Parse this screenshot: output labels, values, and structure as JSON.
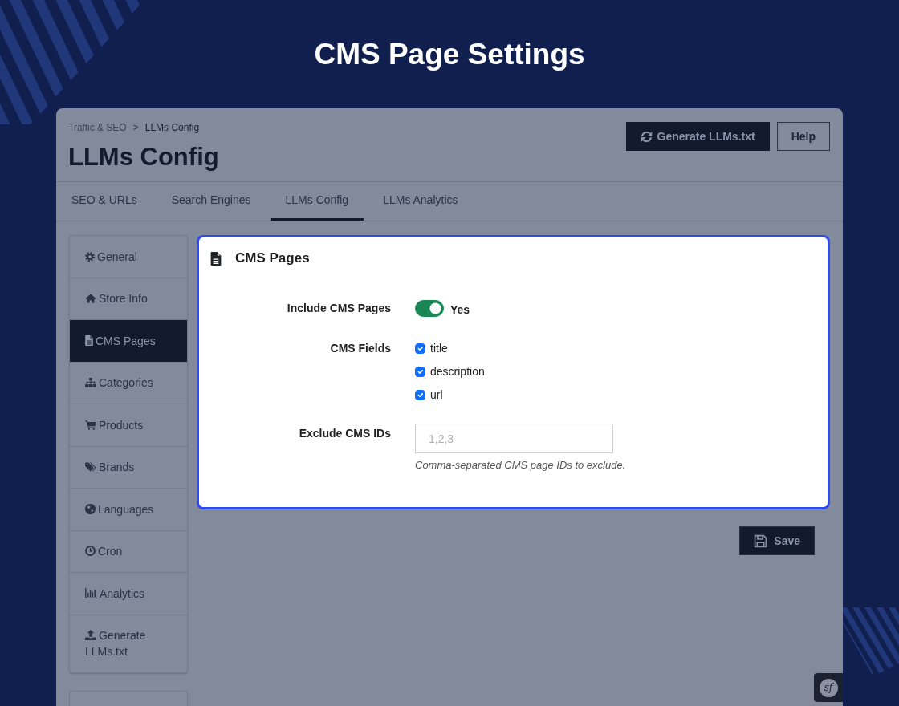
{
  "heading": {
    "title": "CMS Page Settings"
  },
  "header": {
    "breadcrumb": [
      {
        "label": "Traffic & SEO"
      },
      {
        "label": "LLMs Config"
      }
    ],
    "separator": ">",
    "title": "LLMs Config",
    "buttons": [
      {
        "label": "Generate LLMs.txt",
        "kind": "primary"
      },
      {
        "label": "Help",
        "kind": "outline"
      }
    ]
  },
  "tabs": [
    {
      "label": "SEO & URLs",
      "selected": false
    },
    {
      "label": "Search Engines",
      "selected": false
    },
    {
      "label": "LLMs Config",
      "selected": true
    },
    {
      "label": "LLMs Analytics",
      "selected": false
    }
  ],
  "sidebar": {
    "items": [
      {
        "label": "General",
        "selected": false
      },
      {
        "label": "Store Info",
        "selected": false
      },
      {
        "label": "CMS Pages",
        "selected": true
      },
      {
        "label": "Categories",
        "selected": false
      },
      {
        "label": "Products",
        "selected": false
      },
      {
        "label": "Brands",
        "selected": false
      },
      {
        "label": "Languages",
        "selected": false
      },
      {
        "label": "Cron",
        "selected": false
      },
      {
        "label": "Analytics",
        "selected": false
      },
      {
        "label": "Generate LLMs.txt",
        "selected": false
      }
    ]
  },
  "card": {
    "title": "CMS Pages",
    "fields": [
      {
        "kind": "toggle",
        "label": "Include CMS Pages",
        "on": true,
        "value": "Yes"
      },
      {
        "kind": "checkboxes",
        "label": "CMS Fields",
        "options": [
          {
            "label": "title",
            "checked": true
          },
          {
            "label": "description",
            "checked": true
          },
          {
            "label": "url",
            "checked": true
          }
        ]
      },
      {
        "kind": "text",
        "label": "Exclude CMS IDs",
        "placeholder": "1,2,3",
        "help": "Comma-separated CMS page IDs to exclude."
      }
    ]
  },
  "save_button": {
    "label": "Save"
  },
  "toolbar": {
    "logo": "sf"
  }
}
